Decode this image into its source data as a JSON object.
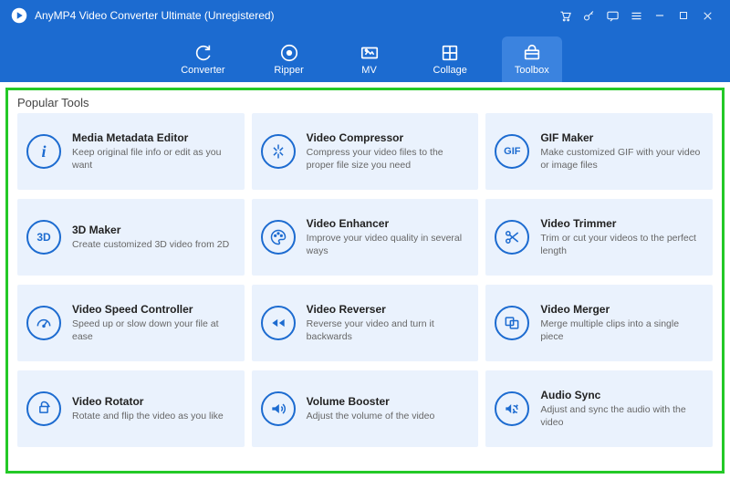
{
  "app": {
    "title": "AnyMP4 Video Converter Ultimate (Unregistered)"
  },
  "tabs": {
    "converter": "Converter",
    "ripper": "Ripper",
    "mv": "MV",
    "collage": "Collage",
    "toolbox": "Toolbox"
  },
  "section": {
    "popular": "Popular Tools"
  },
  "tools": {
    "metadata": {
      "title": "Media Metadata Editor",
      "desc": "Keep original file info or edit as you want",
      "icon": "i"
    },
    "compress": {
      "title": "Video Compressor",
      "desc": "Compress your video files to the proper file size you need"
    },
    "gif": {
      "title": "GIF Maker",
      "desc": "Make customized GIF with your video or image files",
      "icon": "GIF"
    },
    "3d": {
      "title": "3D Maker",
      "desc": "Create customized 3D video from 2D",
      "icon": "3D"
    },
    "enhance": {
      "title": "Video Enhancer",
      "desc": "Improve your video quality in several ways"
    },
    "trim": {
      "title": "Video Trimmer",
      "desc": "Trim or cut your videos to the perfect length"
    },
    "speed": {
      "title": "Video Speed Controller",
      "desc": "Speed up or slow down your file at ease"
    },
    "reverse": {
      "title": "Video Reverser",
      "desc": "Reverse your video and turn it backwards"
    },
    "merge": {
      "title": "Video Merger",
      "desc": "Merge multiple clips into a single piece"
    },
    "rotate": {
      "title": "Video Rotator",
      "desc": "Rotate and flip the video as you like"
    },
    "volume": {
      "title": "Volume Booster",
      "desc": "Adjust the volume of the video"
    },
    "sync": {
      "title": "Audio Sync",
      "desc": "Adjust and sync the audio with the video"
    }
  }
}
